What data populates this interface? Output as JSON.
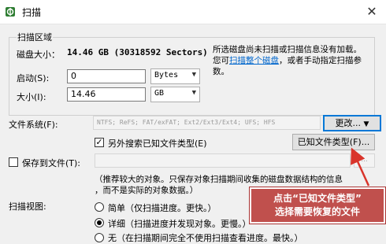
{
  "window": {
    "title": "扫描",
    "close_glyph": "✕"
  },
  "scan_area": {
    "group_title": "扫描区域",
    "disk_size_label": "磁盘大小：",
    "disk_size_value": "14.46 GB (30318592 Sectors)",
    "info_line1": "所选磁盘尚未扫描或扫描信息没有加载。",
    "info_line2_prefix": "您可",
    "info_link": "扫描整个磁盘",
    "info_line2_suffix": "，或者手动指定扫描参",
    "info_line3": "数。",
    "start_label": "启动(S):",
    "start_value": "0",
    "start_unit": "Bytes",
    "size_label": "大小(I):",
    "size_value": "14.46",
    "size_unit": "GB"
  },
  "filesystem": {
    "label": "文件系统(F):",
    "value": "NTFS; ReFS; FAT/exFAT; Ext2/Ext3/Ext4; UFS; HFS",
    "change_button": "更改...",
    "extra_search_label": "另外搜索已知文件类型(E)",
    "extra_search_checked": true,
    "known_types_button": "已知文件类型(F)..."
  },
  "save_to_file": {
    "label": "保存到文件(T):",
    "checked": false,
    "browse_button": "...",
    "hint_line1": "（推荐较大的对象。只保存对象扫描期间收集的磁盘数据结构的信息",
    "hint_line2": "，而不是实际的对象数据。）"
  },
  "scan_view": {
    "label": "扫描视图:",
    "options": [
      {
        "label": "简单（仅扫描进度。更快。）",
        "selected": false
      },
      {
        "label": "详细（扫描进度并发现对象。更慢。）",
        "selected": true
      },
      {
        "label": "无（在扫描期间完全不使用扫描查看进度。最快。）",
        "selected": false
      }
    ]
  },
  "callout": {
    "line1": "点击“已知文件类型”",
    "line2": "选择需要恢复的文件"
  },
  "colors": {
    "callout_bg": "#c0504d",
    "link": "#0066cc",
    "focus": "#0078d7"
  },
  "icons": {
    "app": "scan-app-icon",
    "dropdown": "chevron-down-icon",
    "close": "close-icon"
  }
}
